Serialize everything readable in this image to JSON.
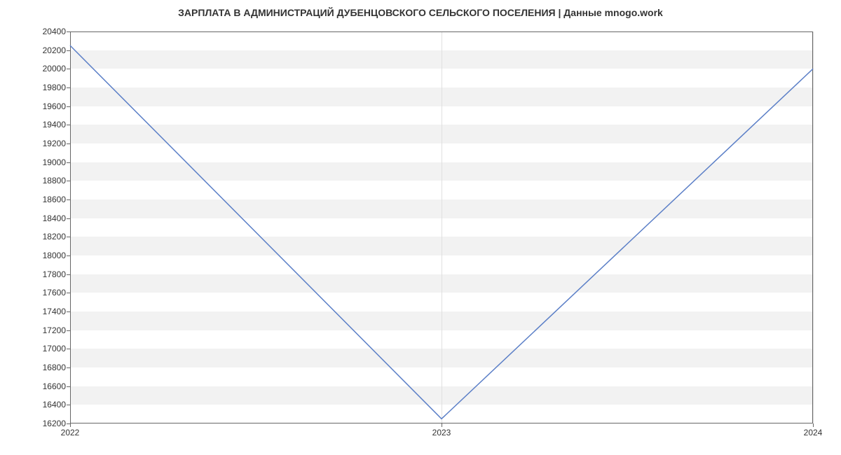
{
  "chart_data": {
    "type": "line",
    "title": "ЗАРПЛАТА В АДМИНИСТРАЦИЙ ДУБЕНЦОВСКОГО СЕЛЬСКОГО ПОСЕЛЕНИЯ | Данные mnogo.work",
    "xlabel": "",
    "ylabel": "",
    "x": [
      "2022",
      "2023",
      "2024"
    ],
    "values": [
      20250,
      16250,
      20000
    ],
    "yticks": [
      16200,
      16400,
      16600,
      16800,
      17000,
      17200,
      17400,
      17600,
      17800,
      18000,
      18200,
      18400,
      18600,
      18800,
      19000,
      19200,
      19400,
      19600,
      19800,
      20000,
      20200,
      20400
    ],
    "ylim": [
      16200,
      20400
    ],
    "line_color": "#5b7fc7"
  }
}
